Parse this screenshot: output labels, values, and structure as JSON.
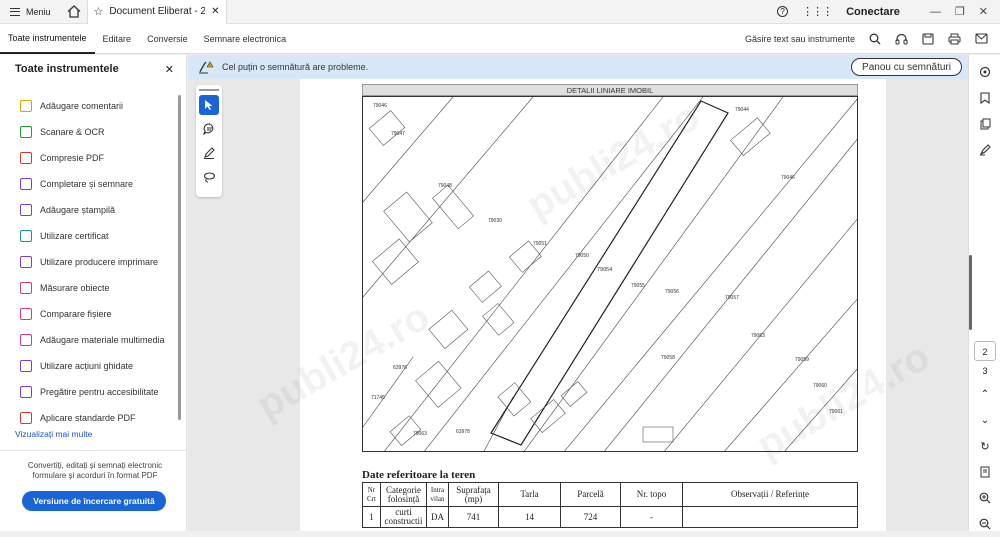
{
  "titlebar": {
    "menu_label": "Meniu",
    "tab_title": "Document Eliberat - 2...",
    "connect_label": "Conectare"
  },
  "toolbar": {
    "tabs": [
      "Toate instrumentele",
      "Editare",
      "Conversie",
      "Semnare electronica"
    ],
    "search_label": "Găsire text sau instrumente"
  },
  "left_panel": {
    "title": "Toate instrumentele",
    "items": [
      {
        "label": "Adăugare comentarii",
        "icon": "comment-icon",
        "color": "#d4a600"
      },
      {
        "label": "Scanare & OCR",
        "icon": "scan-icon",
        "color": "#1f9b3a"
      },
      {
        "label": "Compresie PDF",
        "icon": "compress-icon",
        "color": "#d63a2f"
      },
      {
        "label": "Completare și semnare",
        "icon": "sign-icon",
        "color": "#7b3fd1"
      },
      {
        "label": "Adăugare ștampilă",
        "icon": "stamp-icon",
        "color": "#7b3fd1"
      },
      {
        "label": "Utilizare certificat",
        "icon": "certificate-icon",
        "color": "#1f8fa3"
      },
      {
        "label": "Utilizare producere imprimare",
        "icon": "print-production-icon",
        "color": "#7b3fd1"
      },
      {
        "label": "Măsurare obiecte",
        "icon": "measure-icon",
        "color": "#d63a8f"
      },
      {
        "label": "Comparare fișiere",
        "icon": "compare-icon",
        "color": "#d63a8f"
      },
      {
        "label": "Adăugare materiale multimedia",
        "icon": "multimedia-icon",
        "color": "#d63a8f"
      },
      {
        "label": "Utilizare acțiuni ghidate",
        "icon": "guided-actions-icon",
        "color": "#7b3fd1"
      },
      {
        "label": "Pregătire pentru accesibilitate",
        "icon": "accessibility-icon",
        "color": "#7b3fd1"
      },
      {
        "label": "Aplicare standarde PDF",
        "icon": "pdf-standards-icon",
        "color": "#d63a2f"
      }
    ],
    "more_label": "Vizualizați mai multe",
    "promo_text": "Convertiți, editați și semnați electronic formulare și acorduri în format PDF",
    "trial_button": "Versiune de încercare gratuită"
  },
  "infobar": {
    "message": "Cel puțin o semnătură are probleme.",
    "button": "Panou cu semnături"
  },
  "document": {
    "map_header": "DETALII LINIARE IMOBIL",
    "map_parcel_labels": [
      "79044",
      "79047",
      "79046",
      "79048",
      "79030",
      "79051",
      "79050",
      "79054",
      "79055",
      "79056",
      "79057",
      "79063",
      "79059",
      "79058",
      "79060",
      "79061",
      "63976",
      "71745",
      "79063",
      "63978",
      "79046"
    ],
    "teren_title": "Date referitoare la teren",
    "table_headers": [
      "Nr Crt",
      "Categorie folosință",
      "Intra vilan",
      "Suprafața (mp)",
      "Tarla",
      "Parcelă",
      "Nr. topo",
      "Observații / Referințe"
    ],
    "table_row": [
      "1",
      "curti constructii",
      "DA",
      "741",
      "14",
      "724",
      "-",
      ""
    ]
  },
  "right_bar": {
    "pages": [
      "2",
      "3"
    ]
  },
  "watermark": "publi24.ro"
}
